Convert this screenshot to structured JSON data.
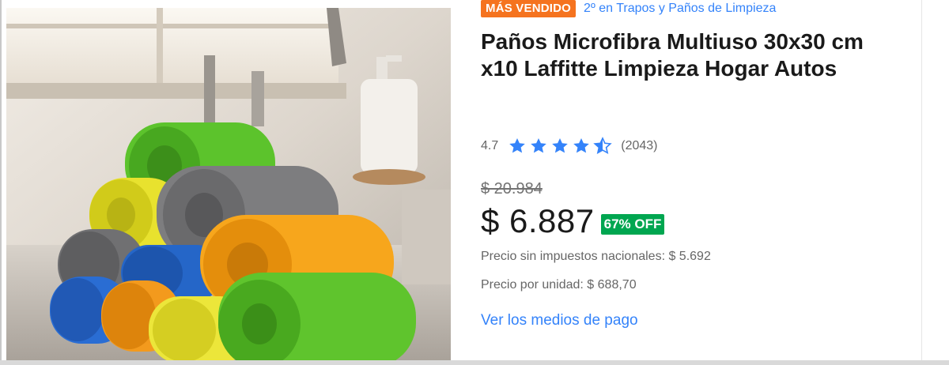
{
  "badges": {
    "best_seller": "MÁS VENDIDO",
    "ranking": "2º en Trapos y Paños de Limpieza"
  },
  "product": {
    "title": "Paños Microfibra Multiuso 30x30 cm x10 Laffitte Limpieza Hogar Autos",
    "image_subject": "rolled-microfiber-cloths"
  },
  "rating": {
    "value": "4.7",
    "stars": 4.5,
    "reviews": "(2043)"
  },
  "pricing": {
    "original": "$ 20.984",
    "current": "$ 6.887",
    "discount": "67% OFF",
    "tax_note": "Precio sin impuestos nacionales: $ 5.692",
    "unit_price": "Precio por unidad: $ 688,70"
  },
  "links": {
    "payment_methods": "Ver los medios de pago"
  },
  "colors": {
    "accent_link": "#3483fa",
    "best_seller_bg": "#f5731f",
    "discount_bg": "#00a650",
    "star": "#3483fa"
  }
}
